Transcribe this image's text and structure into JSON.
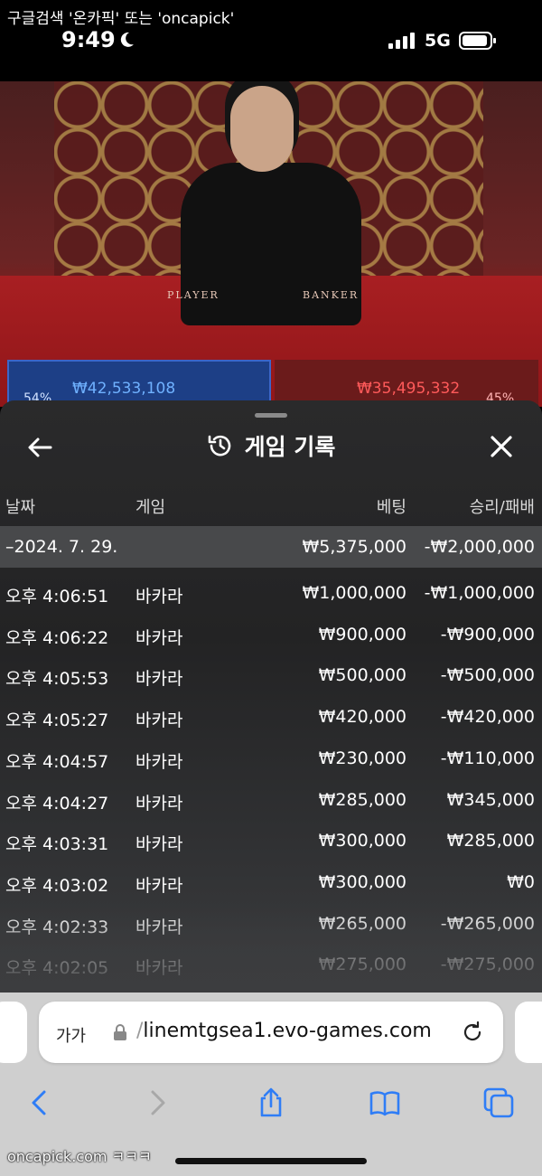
{
  "status_bar": {
    "watermark": "구글검색 '온카픽' 또는 'oncapick'",
    "time": "9:49",
    "network": "5G"
  },
  "game_view": {
    "player_label": "PLAYER",
    "banker_label": "BANKER",
    "player_amount": "₩42,533,108",
    "banker_amount": "₩35,495,332",
    "player_pct": "54%",
    "banker_pct": "45%"
  },
  "history": {
    "title": "게임 기록",
    "columns": {
      "date": "날짜",
      "game": "게임",
      "bet": "베팅",
      "result": "승리/패배"
    },
    "date_group": {
      "date": "–2024. 7. 29.",
      "total_bet": "₩5,375,000",
      "total_result": "-₩2,000,000"
    },
    "rows": [
      {
        "time": "오후 4:06:51",
        "game": "바카라",
        "bet": "₩1,000,000",
        "result": "-₩1,000,000"
      },
      {
        "time": "오후 4:06:22",
        "game": "바카라",
        "bet": "₩900,000",
        "result": "-₩900,000"
      },
      {
        "time": "오후 4:05:53",
        "game": "바카라",
        "bet": "₩500,000",
        "result": "-₩500,000"
      },
      {
        "time": "오후 4:05:27",
        "game": "바카라",
        "bet": "₩420,000",
        "result": "-₩420,000"
      },
      {
        "time": "오후 4:04:57",
        "game": "바카라",
        "bet": "₩230,000",
        "result": "-₩110,000"
      },
      {
        "time": "오후 4:04:27",
        "game": "바카라",
        "bet": "₩285,000",
        "result": "₩345,000"
      },
      {
        "time": "오후 4:03:31",
        "game": "바카라",
        "bet": "₩300,000",
        "result": "₩285,000"
      },
      {
        "time": "오후 4:03:02",
        "game": "바카라",
        "bet": "₩300,000",
        "result": "₩0"
      },
      {
        "time": "오후 4:02:33",
        "game": "바카라",
        "bet": "₩265,000",
        "result": "-₩265,000"
      },
      {
        "time": "오후 4:02:05",
        "game": "바카라",
        "bet": "₩275,000",
        "result": "-₩275,000"
      }
    ]
  },
  "browser": {
    "text_size_label": "가가",
    "url_slash": "/",
    "url": "linemtgsea1.evo-games.com"
  },
  "watermark_bottom": "oncapick.com ㅋㅋㅋ",
  "colors": {
    "panel_bg": "#2a2a2b",
    "date_row_bg": "#48494b",
    "player_blue": "#6fb1ff",
    "banker_red": "#ff5a5a",
    "safari_blue": "#2f7df6"
  }
}
